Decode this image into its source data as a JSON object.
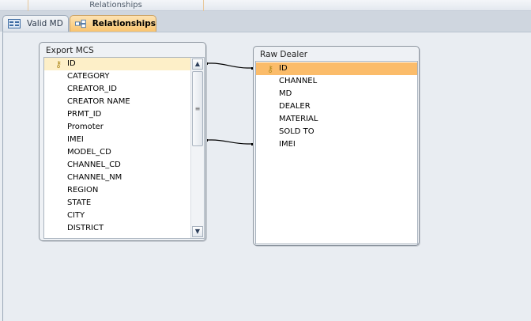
{
  "ribbon": {
    "group_label": "Relationships"
  },
  "tabs": [
    {
      "label": "Valid MD",
      "icon": "form-icon",
      "active": false
    },
    {
      "label": "Relationships",
      "icon": "relationships-icon",
      "active": true
    }
  ],
  "tables": [
    {
      "title": "Export MCS",
      "fields": [
        "ID",
        "CATEGORY",
        "CREATOR_ID",
        "CREATOR NAME",
        "PRMT_ID",
        "Promoter",
        "IMEI",
        "MODEL_CD",
        "CHANNEL_CD",
        "CHANNEL_NM",
        "REGION",
        "STATE",
        "CITY",
        "DISTRICT"
      ],
      "primary_key": "ID"
    },
    {
      "title": "Raw Dealer",
      "fields": [
        "ID",
        "CHANNEL",
        "MD",
        "DEALER",
        "MATERIAL",
        "SOLD TO",
        "IMEI"
      ],
      "primary_key": "ID"
    }
  ],
  "relationships": [
    {
      "from": "Export MCS.ID",
      "to": "Raw Dealer.ID"
    },
    {
      "from": "Export MCS.IMEI",
      "to": "Raw Dealer.IMEI"
    }
  ],
  "colors": {
    "selected_row": "#fbbc6a",
    "key_row": "#fdefc8",
    "active_tab": "#f9c46f"
  }
}
